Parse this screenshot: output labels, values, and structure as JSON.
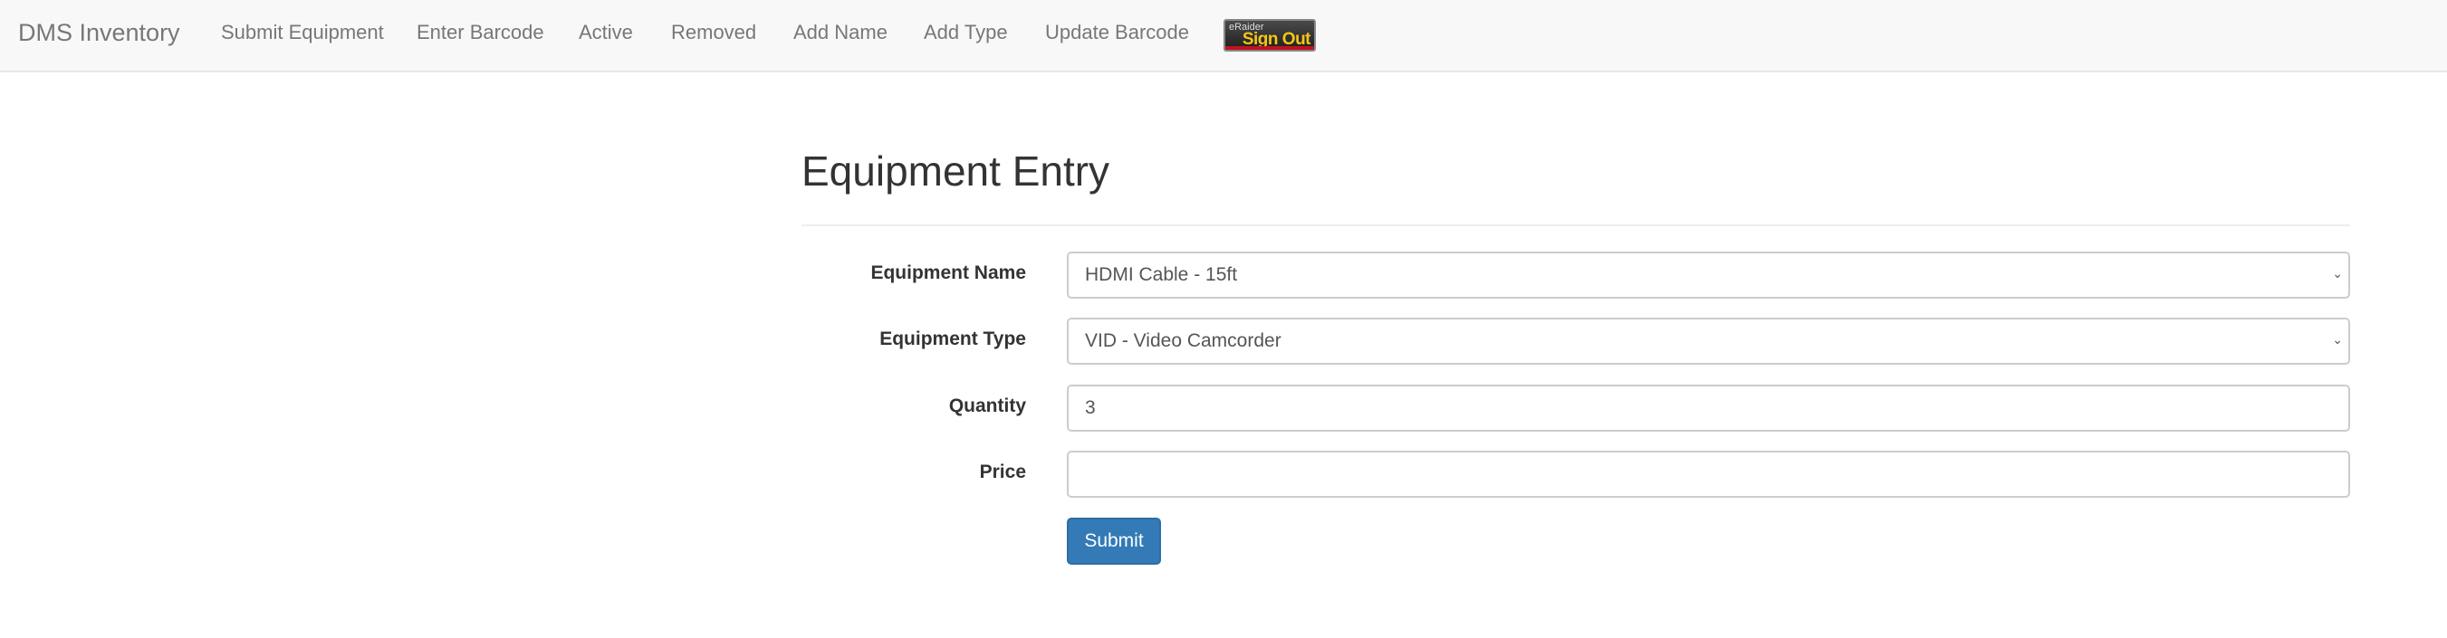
{
  "navbar": {
    "brand": "DMS Inventory",
    "links": [
      {
        "label": "Submit Equipment"
      },
      {
        "label": "Enter Barcode"
      },
      {
        "label": "Active"
      },
      {
        "label": "Removed"
      },
      {
        "label": "Add Name"
      },
      {
        "label": "Add Type"
      },
      {
        "label": "Update Barcode"
      }
    ],
    "signout": {
      "small_text": "eRaider",
      "text": "Sign Out"
    }
  },
  "form": {
    "title": "Equipment Entry",
    "fields": {
      "equipment_name": {
        "label": "Equipment Name",
        "value": "HDMI Cable - 15ft"
      },
      "equipment_type": {
        "label": "Equipment Type",
        "value": "VID - Video Camcorder"
      },
      "quantity": {
        "label": "Quantity",
        "value": "3"
      },
      "price": {
        "label": "Price",
        "value": ""
      }
    },
    "submit_label": "Submit"
  },
  "colors": {
    "navbar_bg": "#f8f8f8",
    "primary_button": "#337ab7",
    "signout_text": "#f5c518",
    "signout_accent": "#c0141b"
  }
}
